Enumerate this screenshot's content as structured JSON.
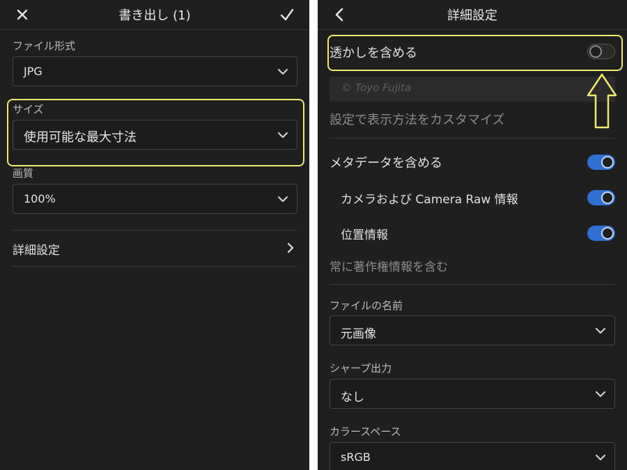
{
  "left": {
    "header": {
      "title": "書き出し (1)",
      "close_icon": "close-icon",
      "confirm_icon": "checkmark-icon"
    },
    "file_format": {
      "label": "ファイル形式",
      "value": "JPG"
    },
    "size": {
      "label": "サイズ",
      "value": "使用可能な最大寸法"
    },
    "quality": {
      "label": "画質",
      "value": "100%"
    },
    "advanced": {
      "label": "詳細設定"
    }
  },
  "right": {
    "header": {
      "title": "詳細設定",
      "back_icon": "back-chevron-icon"
    },
    "watermark": {
      "label": "透かしを含める",
      "enabled": false,
      "preview_text": "© Toyo Fujita"
    },
    "customize": {
      "label": "設定で表示方法をカスタマイズ"
    },
    "metadata": {
      "label": "メタデータを含める",
      "enabled": true
    },
    "camera_raw": {
      "label": "カメラおよび Camera Raw 情報",
      "enabled": true
    },
    "location": {
      "label": "位置情報",
      "enabled": true
    },
    "copyright": {
      "label": "常に著作権情報を含む"
    },
    "file_name": {
      "label": "ファイルの名前",
      "value": "元画像"
    },
    "sharpen": {
      "label": "シャープ出力",
      "value": "なし"
    },
    "color_space": {
      "label": "カラースペース",
      "value": "sRGB"
    }
  },
  "colors": {
    "highlight": "#f2ea6e",
    "toggle_on": "#2f6fd6",
    "background": "#1f1f1f"
  }
}
